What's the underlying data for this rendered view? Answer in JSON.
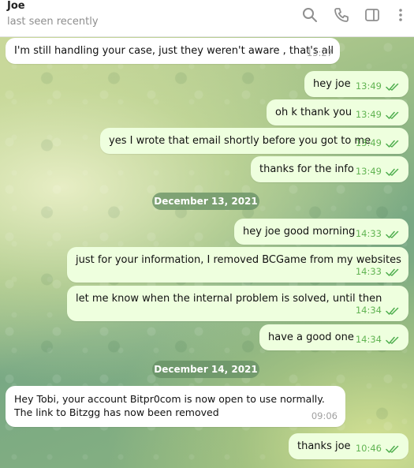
{
  "header": {
    "contact_name": "Joe",
    "status": "last seen recently",
    "icons": [
      "search-icon",
      "phone-icon",
      "sidebar-toggle-icon",
      "more-icon"
    ]
  },
  "colors": {
    "incoming_bubble": "#ffffff",
    "outgoing_bubble": "#eeffde",
    "outgoing_time": "#62b453",
    "read_ticks": "#4fae4e"
  },
  "dates": [
    "December 13, 2021",
    "December 14, 2021"
  ],
  "messages": [
    {
      "direction": "in",
      "text": "I'm still handling your case, just they weren't aware , that's all",
      "time": "13:27"
    },
    {
      "direction": "out",
      "text": "hey joe",
      "time": "13:49",
      "status": "read"
    },
    {
      "direction": "out",
      "text": "oh k thank you",
      "time": "13:49",
      "status": "read"
    },
    {
      "direction": "out",
      "text": "yes I wrote that email shortly before you got to me",
      "time": "13:49",
      "status": "read"
    },
    {
      "direction": "out",
      "text": "thanks for the info",
      "time": "13:49",
      "status": "read"
    },
    {
      "direction": "out",
      "text": "hey joe good morning",
      "time": "14:33",
      "status": "read"
    },
    {
      "direction": "out",
      "text": "just for your information, I removed BCGame from my websites",
      "time": "14:33",
      "status": "read"
    },
    {
      "direction": "out",
      "text": "let me know when the internal problem is solved, until then",
      "time": "14:34",
      "status": "read"
    },
    {
      "direction": "out",
      "text": "have a good one",
      "time": "14:34",
      "status": "read"
    },
    {
      "direction": "in",
      "text": "Hey Tobi, your account Bitpr0com is now open to use normally. The link to Bitzgg has now been removed",
      "time": "09:06"
    },
    {
      "direction": "out",
      "text": "thanks joe",
      "time": "10:46",
      "status": "read"
    }
  ]
}
